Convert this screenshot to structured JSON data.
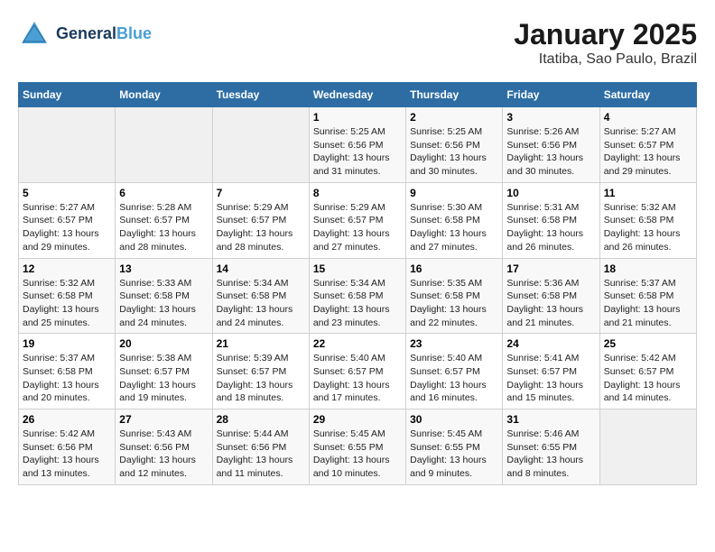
{
  "header": {
    "logo_line1": "General",
    "logo_line2": "Blue",
    "title": "January 2025",
    "subtitle": "Itatiba, Sao Paulo, Brazil"
  },
  "weekdays": [
    "Sunday",
    "Monday",
    "Tuesday",
    "Wednesday",
    "Thursday",
    "Friday",
    "Saturday"
  ],
  "weeks": [
    [
      {
        "day": "",
        "info": ""
      },
      {
        "day": "",
        "info": ""
      },
      {
        "day": "",
        "info": ""
      },
      {
        "day": "1",
        "info": "Sunrise: 5:25 AM\nSunset: 6:56 PM\nDaylight: 13 hours\nand 31 minutes."
      },
      {
        "day": "2",
        "info": "Sunrise: 5:25 AM\nSunset: 6:56 PM\nDaylight: 13 hours\nand 30 minutes."
      },
      {
        "day": "3",
        "info": "Sunrise: 5:26 AM\nSunset: 6:56 PM\nDaylight: 13 hours\nand 30 minutes."
      },
      {
        "day": "4",
        "info": "Sunrise: 5:27 AM\nSunset: 6:57 PM\nDaylight: 13 hours\nand 29 minutes."
      }
    ],
    [
      {
        "day": "5",
        "info": "Sunrise: 5:27 AM\nSunset: 6:57 PM\nDaylight: 13 hours\nand 29 minutes."
      },
      {
        "day": "6",
        "info": "Sunrise: 5:28 AM\nSunset: 6:57 PM\nDaylight: 13 hours\nand 28 minutes."
      },
      {
        "day": "7",
        "info": "Sunrise: 5:29 AM\nSunset: 6:57 PM\nDaylight: 13 hours\nand 28 minutes."
      },
      {
        "day": "8",
        "info": "Sunrise: 5:29 AM\nSunset: 6:57 PM\nDaylight: 13 hours\nand 27 minutes."
      },
      {
        "day": "9",
        "info": "Sunrise: 5:30 AM\nSunset: 6:58 PM\nDaylight: 13 hours\nand 27 minutes."
      },
      {
        "day": "10",
        "info": "Sunrise: 5:31 AM\nSunset: 6:58 PM\nDaylight: 13 hours\nand 26 minutes."
      },
      {
        "day": "11",
        "info": "Sunrise: 5:32 AM\nSunset: 6:58 PM\nDaylight: 13 hours\nand 26 minutes."
      }
    ],
    [
      {
        "day": "12",
        "info": "Sunrise: 5:32 AM\nSunset: 6:58 PM\nDaylight: 13 hours\nand 25 minutes."
      },
      {
        "day": "13",
        "info": "Sunrise: 5:33 AM\nSunset: 6:58 PM\nDaylight: 13 hours\nand 24 minutes."
      },
      {
        "day": "14",
        "info": "Sunrise: 5:34 AM\nSunset: 6:58 PM\nDaylight: 13 hours\nand 24 minutes."
      },
      {
        "day": "15",
        "info": "Sunrise: 5:34 AM\nSunset: 6:58 PM\nDaylight: 13 hours\nand 23 minutes."
      },
      {
        "day": "16",
        "info": "Sunrise: 5:35 AM\nSunset: 6:58 PM\nDaylight: 13 hours\nand 22 minutes."
      },
      {
        "day": "17",
        "info": "Sunrise: 5:36 AM\nSunset: 6:58 PM\nDaylight: 13 hours\nand 21 minutes."
      },
      {
        "day": "18",
        "info": "Sunrise: 5:37 AM\nSunset: 6:58 PM\nDaylight: 13 hours\nand 21 minutes."
      }
    ],
    [
      {
        "day": "19",
        "info": "Sunrise: 5:37 AM\nSunset: 6:58 PM\nDaylight: 13 hours\nand 20 minutes."
      },
      {
        "day": "20",
        "info": "Sunrise: 5:38 AM\nSunset: 6:57 PM\nDaylight: 13 hours\nand 19 minutes."
      },
      {
        "day": "21",
        "info": "Sunrise: 5:39 AM\nSunset: 6:57 PM\nDaylight: 13 hours\nand 18 minutes."
      },
      {
        "day": "22",
        "info": "Sunrise: 5:40 AM\nSunset: 6:57 PM\nDaylight: 13 hours\nand 17 minutes."
      },
      {
        "day": "23",
        "info": "Sunrise: 5:40 AM\nSunset: 6:57 PM\nDaylight: 13 hours\nand 16 minutes."
      },
      {
        "day": "24",
        "info": "Sunrise: 5:41 AM\nSunset: 6:57 PM\nDaylight: 13 hours\nand 15 minutes."
      },
      {
        "day": "25",
        "info": "Sunrise: 5:42 AM\nSunset: 6:57 PM\nDaylight: 13 hours\nand 14 minutes."
      }
    ],
    [
      {
        "day": "26",
        "info": "Sunrise: 5:42 AM\nSunset: 6:56 PM\nDaylight: 13 hours\nand 13 minutes."
      },
      {
        "day": "27",
        "info": "Sunrise: 5:43 AM\nSunset: 6:56 PM\nDaylight: 13 hours\nand 12 minutes."
      },
      {
        "day": "28",
        "info": "Sunrise: 5:44 AM\nSunset: 6:56 PM\nDaylight: 13 hours\nand 11 minutes."
      },
      {
        "day": "29",
        "info": "Sunrise: 5:45 AM\nSunset: 6:55 PM\nDaylight: 13 hours\nand 10 minutes."
      },
      {
        "day": "30",
        "info": "Sunrise: 5:45 AM\nSunset: 6:55 PM\nDaylight: 13 hours\nand 9 minutes."
      },
      {
        "day": "31",
        "info": "Sunrise: 5:46 AM\nSunset: 6:55 PM\nDaylight: 13 hours\nand 8 minutes."
      },
      {
        "day": "",
        "info": ""
      }
    ]
  ]
}
